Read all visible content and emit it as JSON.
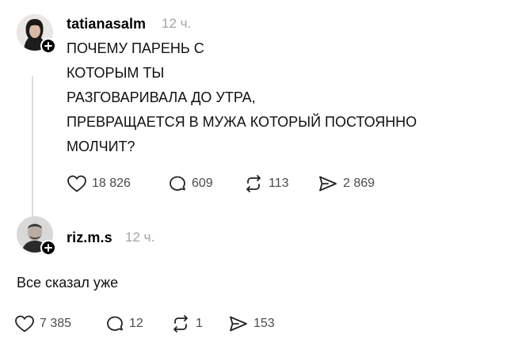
{
  "posts": [
    {
      "username": "tatianasalm",
      "time": "12 ч.",
      "lines": [
        "ПОЧЕМУ ПАРЕНЬ С",
        "КОТОРЫМ ТЫ",
        "РАЗГОВАРИВАЛА ДО УТРА,",
        "ПРЕВРАЩАЕТСЯ В МУЖА КОТОРЫЙ ПОСТОЯННО",
        "МОЛЧИТ?"
      ],
      "likes": "18 826",
      "replies": "609",
      "reposts": "113",
      "shares": "2 869"
    },
    {
      "username": "riz.m.s",
      "time": "12 ч.",
      "text": "Все сказал уже",
      "likes": "7 385",
      "replies": "12",
      "reposts": "1",
      "shares": "153"
    }
  ],
  "icons": {
    "like": "heart-icon",
    "reply": "comment-icon",
    "repost": "repost-icon",
    "share": "share-icon",
    "follow": "plus-icon"
  }
}
